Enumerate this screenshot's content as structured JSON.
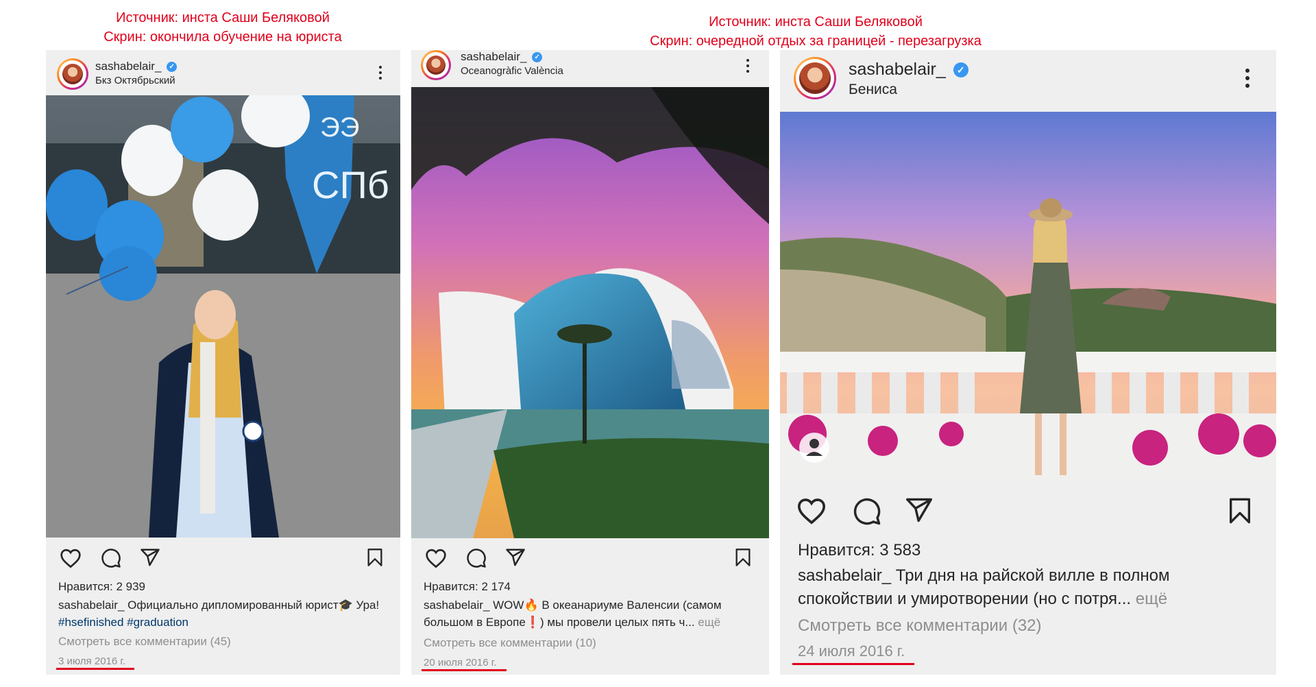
{
  "captions": {
    "left": {
      "line1": "Источник: инста Саши Беляковой",
      "line2": "Скрин: окончила обучение на юриста"
    },
    "right": {
      "line1": "Источник: инста Саши Беляковой",
      "line2": "Скрин: очередной отдых за границей  - перезагрузка"
    }
  },
  "posts": [
    {
      "username": "sashabelair_",
      "location": "Бкз Октябрьский",
      "photo_banner_text1": "ЭЭ",
      "photo_banner_text2": "СПб",
      "likes": "Нравится: 2 939",
      "caption_user": "sashabelair_",
      "caption_text": " Официально дипломированный юрист🎓 Ура! ",
      "tag1": "#hsefinished",
      "tag2": "#graduation",
      "comments": "Смотреть все комментарии (45)",
      "date": "3 июля 2016 г."
    },
    {
      "username": "sashabelair_",
      "location": "Oceanogràfic València",
      "likes": "Нравится: 2 174",
      "caption_user": "sashabelair_",
      "caption_text": " WOW🔥 В океанариуме Валенсии (самом большом в Европе❗) мы провели целых пять ч...",
      "more": " ещё",
      "comments": "Смотреть все комментарии (10)",
      "date": "20 июля 2016 г."
    },
    {
      "username": "sashabelair_",
      "location": "Бениса",
      "likes": "Нравится: 3 583",
      "caption_user": "sashabelair_",
      "caption_text": " Три дня на райской вилле в полном спокойствии и умиротворении (но с потря...",
      "more": " ещё",
      "comments": "Смотреть все комментарии (32)",
      "date": "24 июля 2016 г."
    }
  ],
  "colors": {
    "caption_red": "#e0001b",
    "verified_blue": "#3897f0",
    "card_bg": "#efefef",
    "hashtag": "#00376b"
  },
  "icons": [
    "heart-icon",
    "comment-icon",
    "share-icon",
    "bookmark-icon",
    "more-options-icon",
    "verified-icon"
  ]
}
